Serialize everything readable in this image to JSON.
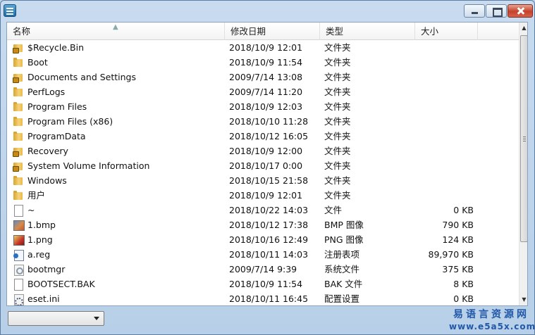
{
  "columns": {
    "name": "名称",
    "date": "修改日期",
    "type": "类型",
    "size": "大小"
  },
  "files": [
    {
      "name": "$Recycle.Bin",
      "date": "2018/10/9 12:01",
      "type": "文件夹",
      "size": "",
      "icon": "locked-folder-icon"
    },
    {
      "name": "Boot",
      "date": "2018/10/9 11:54",
      "type": "文件夹",
      "size": "",
      "icon": "folder-icon"
    },
    {
      "name": "Documents and Settings",
      "date": "2009/7/14 13:08",
      "type": "文件夹",
      "size": "",
      "icon": "locked-folder-icon"
    },
    {
      "name": "PerfLogs",
      "date": "2009/7/14 11:20",
      "type": "文件夹",
      "size": "",
      "icon": "folder-icon"
    },
    {
      "name": "Program Files",
      "date": "2018/10/9 12:03",
      "type": "文件夹",
      "size": "",
      "icon": "folder-icon"
    },
    {
      "name": "Program Files (x86)",
      "date": "2018/10/10 11:28",
      "type": "文件夹",
      "size": "",
      "icon": "folder-icon"
    },
    {
      "name": "ProgramData",
      "date": "2018/10/12 16:05",
      "type": "文件夹",
      "size": "",
      "icon": "folder-icon"
    },
    {
      "name": "Recovery",
      "date": "2018/10/9 12:00",
      "type": "文件夹",
      "size": "",
      "icon": "locked-folder-icon"
    },
    {
      "name": "System Volume Information",
      "date": "2018/10/17 0:00",
      "type": "文件夹",
      "size": "",
      "icon": "locked-folder-icon"
    },
    {
      "name": "Windows",
      "date": "2018/10/15 21:58",
      "type": "文件夹",
      "size": "",
      "icon": "folder-icon"
    },
    {
      "name": "用户",
      "date": "2018/10/9 12:01",
      "type": "文件夹",
      "size": "",
      "icon": "folder-icon"
    },
    {
      "name": "~",
      "date": "2018/10/22 14:03",
      "type": "文件",
      "size": "0 KB",
      "icon": "file-icon"
    },
    {
      "name": "1.bmp",
      "date": "2018/10/12 17:38",
      "type": "BMP 图像",
      "size": "790 KB",
      "icon": "bmp-icon"
    },
    {
      "name": "1.png",
      "date": "2018/10/16 12:49",
      "type": "PNG 图像",
      "size": "124 KB",
      "icon": "png-icon"
    },
    {
      "name": "a.reg",
      "date": "2018/10/11 14:03",
      "type": "注册表项",
      "size": "89,970 KB",
      "icon": "reg-icon"
    },
    {
      "name": "bootmgr",
      "date": "2009/7/14 9:39",
      "type": "系统文件",
      "size": "375 KB",
      "icon": "sys-icon"
    },
    {
      "name": "BOOTSECT.BAK",
      "date": "2018/10/9 11:54",
      "type": "BAK 文件",
      "size": "8 KB",
      "icon": "file-icon"
    },
    {
      "name": "eset.ini",
      "date": "2018/10/11 16:45",
      "type": "配置设置",
      "size": "0 KB",
      "icon": "ini-icon"
    }
  ],
  "combo": {
    "value": ""
  },
  "watermark": {
    "line1": "易语言资源网",
    "line2": "www.e5a5x.com"
  }
}
